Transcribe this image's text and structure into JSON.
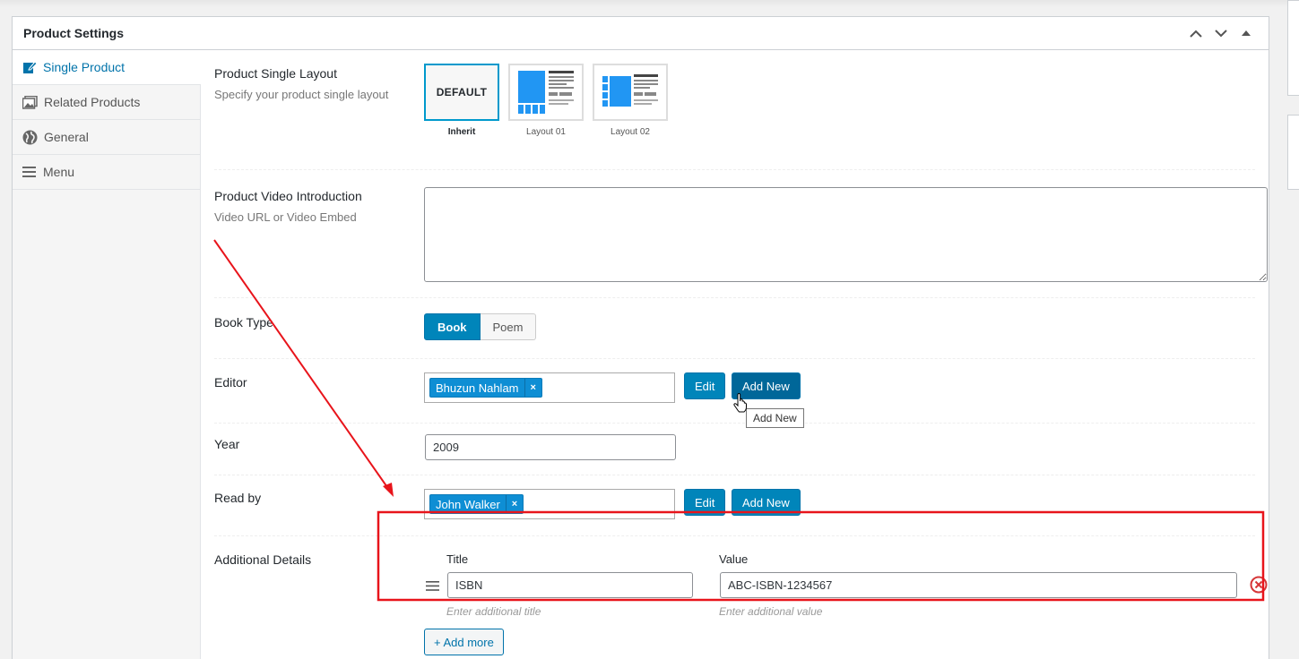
{
  "panel": {
    "title": "Product Settings"
  },
  "tabs": [
    {
      "label": "Single Product",
      "icon": "edit-icon"
    },
    {
      "label": "Related Products",
      "icon": "gallery-icon"
    },
    {
      "label": "General",
      "icon": "globe-icon"
    },
    {
      "label": "Menu",
      "icon": "menu-icon"
    }
  ],
  "layout_field": {
    "label": "Product Single Layout",
    "desc": "Specify your product single layout",
    "options": [
      {
        "caption": "Inherit",
        "text": "DEFAULT",
        "selected": true
      },
      {
        "caption": "Layout 01"
      },
      {
        "caption": "Layout 02"
      }
    ]
  },
  "video_field": {
    "label": "Product Video Introduction",
    "desc": "Video URL or Video Embed"
  },
  "book_type": {
    "label": "Book Type",
    "options": [
      "Book",
      "Poem"
    ],
    "selected": "Book"
  },
  "editor": {
    "label": "Editor",
    "chip": "Bhuzun Nahlam",
    "chip_remove": "×",
    "edit_label": "Edit",
    "add_label": "Add New",
    "tooltip": "Add New"
  },
  "year": {
    "label": "Year",
    "value": "2009"
  },
  "read_by": {
    "label": "Read by",
    "chip": "John Walker",
    "chip_remove": "×",
    "edit_label": "Edit",
    "add_label": "Add New"
  },
  "additional": {
    "label": "Additional Details",
    "title_head": "Title",
    "value_head": "Value",
    "title_value": "ISBN",
    "value_value": "ABC-ISBN-1234567",
    "title_hint": "Enter additional title",
    "value_hint": "Enter additional value",
    "add_more": "+ Add more"
  },
  "colors": {
    "primary": "#0085ba",
    "annotation": "#e8141b",
    "chip": "#0e8ed4"
  }
}
